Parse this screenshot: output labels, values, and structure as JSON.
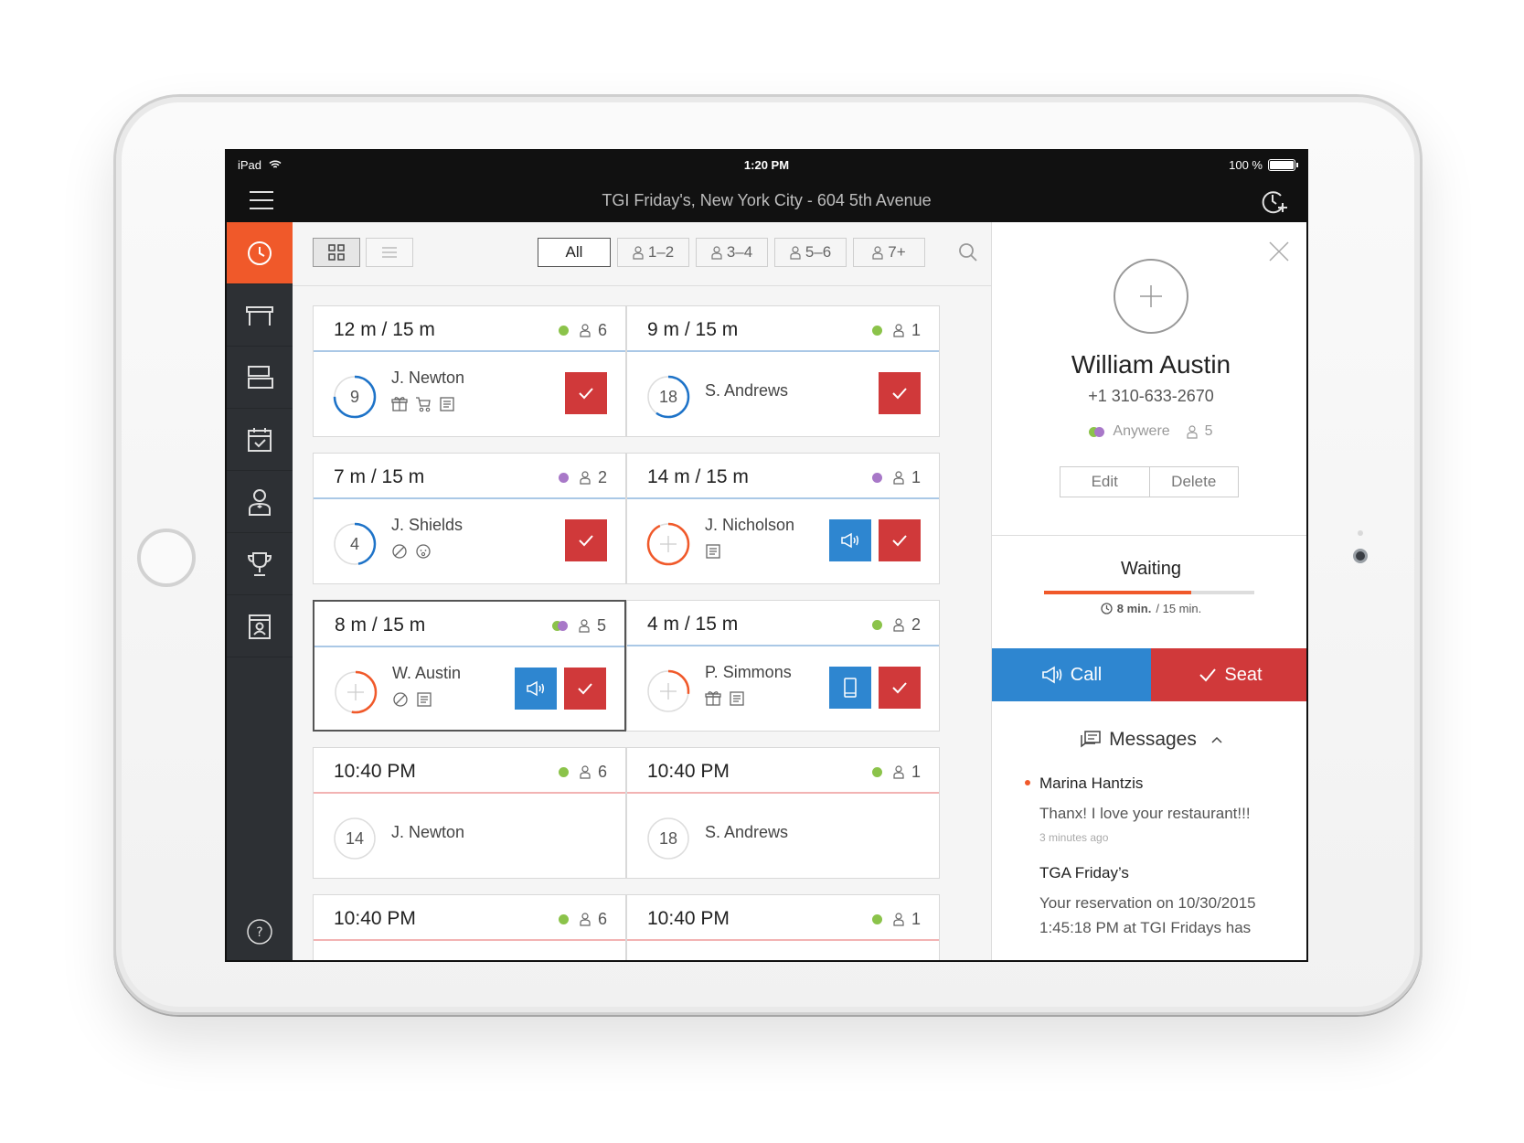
{
  "status_bar": {
    "device": "iPad",
    "time": "1:20 PM",
    "battery": "100 %"
  },
  "app_bar": {
    "title": "TGI Friday's, New York City - 604 5th Avenue"
  },
  "filters": [
    "All",
    "1–2",
    "3–4",
    "5–6",
    "7+"
  ],
  "cards": [
    {
      "time": "12 m / 15 m",
      "party": "6",
      "dot": "#8bc34a",
      "guest": "J. Newton",
      "number": "9",
      "progress": 0.75,
      "ring_color": "#1e73c8",
      "tags": [
        "gift-icon",
        "stroller-icon",
        "note-icon"
      ],
      "actions": [
        "seat"
      ]
    },
    {
      "time": "9 m / 15 m",
      "party": "1",
      "dot": "#8bc34a",
      "guest": "S. Andrews",
      "number": "18",
      "progress": 0.6,
      "ring_color": "#1e73c8",
      "tags": [],
      "actions": [
        "seat"
      ]
    },
    {
      "time": "7 m / 15 m",
      "party": "2",
      "dot": "#a878c8",
      "guest": "J. Shields",
      "number": "4",
      "progress": 0.47,
      "ring_color": "#1e73c8",
      "tags": [
        "no-icon",
        "baby-icon"
      ],
      "actions": [
        "seat"
      ]
    },
    {
      "time": "14 m / 15 m",
      "party": "1",
      "dot": "#a878c8",
      "guest": "J. Nicholson",
      "number": "",
      "progress": 0.93,
      "ring_color": "#f0592a",
      "tags": [
        "note-icon"
      ],
      "actions": [
        "call",
        "seat"
      ]
    },
    {
      "time": "8 m / 15 m",
      "party": "5",
      "dot": "#8bc34a",
      "dot2": "#a878c8",
      "guest": "W. Austin",
      "number": "",
      "progress": 0.53,
      "ring_color": "#f0592a",
      "tags": [
        "no-icon",
        "note-icon"
      ],
      "actions": [
        "call",
        "seat"
      ],
      "selected": true
    },
    {
      "time": "4 m / 15 m",
      "party": "2",
      "dot": "#8bc34a",
      "guest": "P. Simmons",
      "number": "",
      "progress": 0.27,
      "ring_color": "#f0592a",
      "tags": [
        "gift-icon",
        "note-icon"
      ],
      "actions": [
        "text",
        "seat"
      ]
    },
    {
      "time": "10:40 PM",
      "party": "6",
      "dot": "#8bc34a",
      "guest": "J. Newton",
      "number": "14",
      "progress": 0,
      "ring_color": "#aaaaaa",
      "tags": [],
      "actions": [],
      "reservation": true
    },
    {
      "time": "10:40 PM",
      "party": "1",
      "dot": "#8bc34a",
      "guest": "S. Andrews",
      "number": "18",
      "progress": 0,
      "ring_color": "#aaaaaa",
      "tags": [],
      "actions": [],
      "reservation": true
    },
    {
      "time": "10:40 PM",
      "party": "6",
      "dot": "#8bc34a",
      "guest": "",
      "number": "",
      "progress": 0,
      "ring_color": "#aaaaaa",
      "tags": [],
      "actions": [],
      "reservation": true
    },
    {
      "time": "10:40 PM",
      "party": "1",
      "dot": "#8bc34a",
      "guest": "",
      "number": "",
      "progress": 0,
      "ring_color": "#aaaaaa",
      "tags": [],
      "actions": [],
      "reservation": true
    }
  ],
  "detail": {
    "name": "William Austin",
    "phone": "+1 310-633-2670",
    "area": "Anywere",
    "party": "5",
    "edit_label": "Edit",
    "delete_label": "Delete",
    "status": "Waiting",
    "waited": "8 min.",
    "quoted": "/ 15 min.",
    "wait_progress": 0.7,
    "call_label": "Call",
    "seat_label": "Seat",
    "messages_label": "Messages",
    "messages": [
      {
        "from": "Marina Hantzis",
        "text": "Thanx! I love your restaurant!!!",
        "ago": "3 minutes ago",
        "unread": true
      },
      {
        "from": "TGA Friday’s",
        "text": "Your reservation on 10/30/2015 1:45:18 PM at TGI Fridays has",
        "ago": "",
        "unread": false
      }
    ]
  },
  "colors": {
    "accent": "#f0592a",
    "blue": "#2e86d0",
    "red": "#d0393a",
    "sidebar": "#2d3034",
    "green_dot": "#8bc34a",
    "purple_dot": "#a878c8"
  }
}
